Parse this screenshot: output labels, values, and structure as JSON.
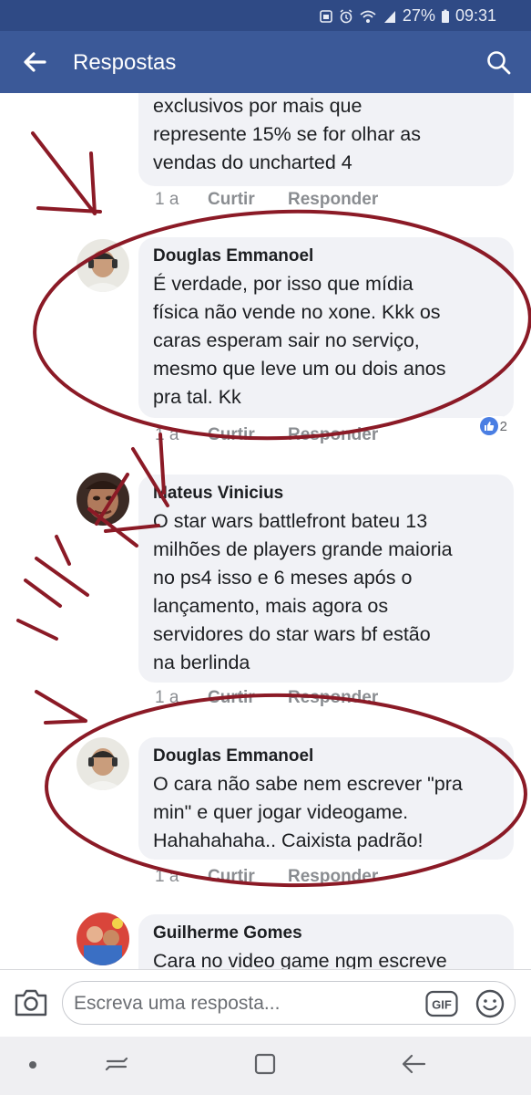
{
  "status_bar": {
    "battery": "27%",
    "time": "09:31",
    "icons": [
      "sim-icon",
      "alarm-icon",
      "wifi-icon",
      "signal-icon",
      "battery-icon"
    ]
  },
  "app_bar": {
    "title": "Respostas",
    "back_icon": "arrow-left-icon",
    "search_icon": "search-icon"
  },
  "comments": [
    {
      "author": "",
      "lines": [
        "exclusivos por mais que",
        "represente 15% se for olhar as",
        "vendas do uncharted 4"
      ],
      "age": "1 a",
      "like": "Curtir",
      "reply": "Responder"
    },
    {
      "author": "Douglas Emmanoel",
      "lines": [
        "É verdade, por isso que mídia",
        "física não vende no xone. Kkk os",
        "caras esperam sair no serviço,",
        "mesmo que leve um ou dois anos",
        "pra tal. Kk"
      ],
      "age": "1 a",
      "like": "Curtir",
      "reply": "Responder",
      "reactions": "2"
    },
    {
      "author": "Mateus Vinicius",
      "lines": [
        "O star wars battlefront bateu 13",
        "milhões de players grande maioria",
        "no ps4 isso e 6 meses após o",
        "lançamento, mais agora os",
        "servidores do star wars bf estão",
        "na berlinda"
      ],
      "age": "1 a",
      "like": "Curtir",
      "reply": "Responder"
    },
    {
      "author": "Douglas Emmanoel",
      "lines": [
        "O cara não sabe nem escrever \"pra",
        "min\" e quer jogar videogame.",
        "Hahahahaha.. Caixista padrão!"
      ],
      "age": "1 a",
      "like": "Curtir",
      "reply": "Responder"
    },
    {
      "author": "Guilherme Gomes",
      "lines": [
        "Cara no video game ngm escreve"
      ]
    }
  ],
  "composer": {
    "placeholder": "Escreva uma resposta...",
    "gif_label": "GIF",
    "camera_icon": "camera-icon",
    "emoji_icon": "emoji-icon"
  },
  "nav_bar": {
    "icons": [
      "dot-icon",
      "recent-apps-icon",
      "home-icon",
      "back-icon"
    ]
  },
  "colors": {
    "facebook_blue": "#3b5998",
    "status_bar": "#2f4a85",
    "bubble": "#f1f2f6",
    "annotation": "#8b1a26",
    "reaction_blue": "#4a7ee3"
  }
}
